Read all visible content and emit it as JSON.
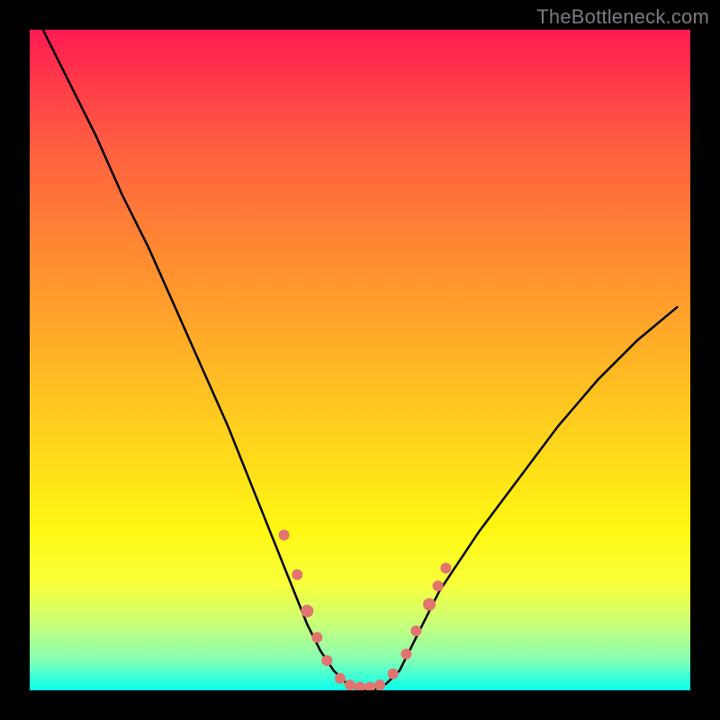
{
  "watermark": "TheBottleneck.com",
  "chart_data": {
    "type": "line",
    "title": "",
    "xlabel": "",
    "ylabel": "",
    "xlim": [
      0,
      100
    ],
    "ylim": [
      0,
      100
    ],
    "series": [
      {
        "name": "curve",
        "x": [
          2,
          6,
          10,
          14,
          18,
          22,
          26,
          30,
          34,
          38,
          40,
          42,
          44,
          46,
          48,
          50,
          52,
          54,
          56,
          58,
          62,
          68,
          74,
          80,
          86,
          92,
          98
        ],
        "y": [
          100,
          92,
          84,
          75,
          67,
          58,
          49,
          40,
          30,
          20,
          15,
          10,
          6,
          3,
          1,
          0,
          0,
          1,
          3,
          7,
          15,
          24,
          32,
          40,
          47,
          53,
          58
        ]
      }
    ],
    "markers": {
      "color": "#e2746f",
      "points": [
        {
          "x": 38.5,
          "y": 23.5,
          "r": 6
        },
        {
          "x": 40.5,
          "y": 17.5,
          "r": 6
        },
        {
          "x": 42.0,
          "y": 12.0,
          "r": 7
        },
        {
          "x": 43.5,
          "y": 8.0,
          "r": 6
        },
        {
          "x": 45.0,
          "y": 4.5,
          "r": 6
        },
        {
          "x": 47.0,
          "y": 1.8,
          "r": 6
        },
        {
          "x": 48.5,
          "y": 0.8,
          "r": 6
        },
        {
          "x": 50.0,
          "y": 0.5,
          "r": 6
        },
        {
          "x": 51.5,
          "y": 0.5,
          "r": 6
        },
        {
          "x": 53.0,
          "y": 0.8,
          "r": 6
        },
        {
          "x": 55.0,
          "y": 2.5,
          "r": 6
        },
        {
          "x": 57.0,
          "y": 5.5,
          "r": 6
        },
        {
          "x": 58.5,
          "y": 9.0,
          "r": 6
        },
        {
          "x": 60.5,
          "y": 13.0,
          "r": 7
        },
        {
          "x": 61.8,
          "y": 15.8,
          "r": 6
        },
        {
          "x": 63.0,
          "y": 18.5,
          "r": 6
        }
      ]
    }
  }
}
